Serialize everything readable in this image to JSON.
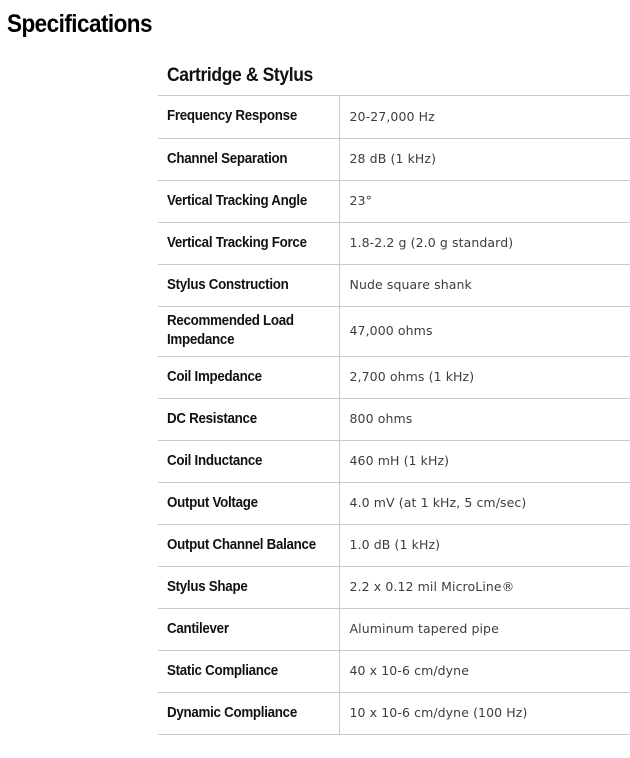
{
  "page": {
    "title": "Specifications"
  },
  "section": {
    "heading": "Cartridge & Stylus"
  },
  "specs": [
    {
      "label": "Frequency Response",
      "value": "20-27,000 Hz"
    },
    {
      "label": "Channel Separation",
      "value": "28 dB (1 kHz)"
    },
    {
      "label": "Vertical Tracking Angle",
      "value": "23°"
    },
    {
      "label": "Vertical Tracking Force",
      "value": "1.8-2.2 g (2.0 g standard)"
    },
    {
      "label": "Stylus Construction",
      "value": "Nude square shank"
    },
    {
      "label": "Recommended Load Impedance",
      "value": "47,000 ohms"
    },
    {
      "label": "Coil Impedance",
      "value": "2,700 ohms (1 kHz)"
    },
    {
      "label": "DC Resistance",
      "value": "800 ohms"
    },
    {
      "label": "Coil Inductance",
      "value": "460 mH (1 kHz)"
    },
    {
      "label": "Output Voltage",
      "value": "4.0 mV (at 1 kHz, 5 cm/sec)"
    },
    {
      "label": "Output Channel Balance",
      "value": "1.0 dB (1 kHz)"
    },
    {
      "label": "Stylus Shape",
      "value": "2.2 x 0.12 mil MicroLine®"
    },
    {
      "label": "Cantilever",
      "value": "Aluminum tapered pipe"
    },
    {
      "label": "Static Compliance",
      "value": "40 x 10-6 cm/dyne"
    },
    {
      "label": "Dynamic Compliance",
      "value": "10 x 10-6 cm/dyne (100 Hz)"
    }
  ]
}
